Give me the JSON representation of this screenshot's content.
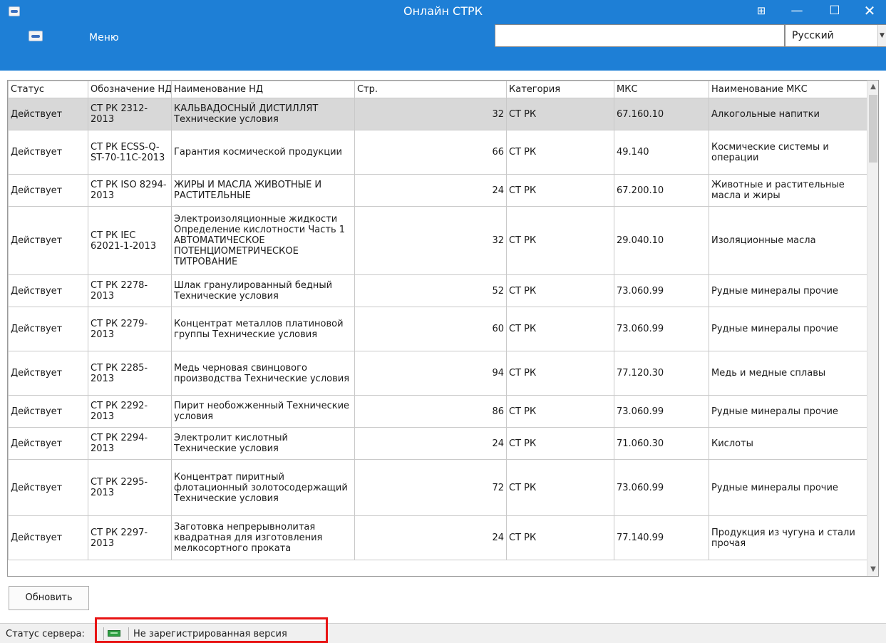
{
  "window": {
    "title": "Онлайн СТРК",
    "pin_icon": "pin-icon",
    "minimize_glyph": "—",
    "maximize_glyph": "☐",
    "close_glyph": "✕"
  },
  "menubar": {
    "menu_label": "Меню",
    "search_value": "",
    "language": "Русский"
  },
  "table": {
    "columns": [
      "Статус",
      "Обозначение НД",
      "Наименование НД",
      "Стр.",
      "Категория",
      "МКС",
      "Наименование МКС"
    ],
    "rows": [
      {
        "status": "Действует",
        "code": "СТ РК 2312-2013",
        "name": " КАЛЬВАДОСНЫЙ ДИСТИЛЛЯТ Технические условия",
        "pages": "32",
        "category": "СТ РК",
        "mks": "67.160.10",
        "mks_name": "Алкогольные напитки"
      },
      {
        "status": "Действует",
        "code": "СТ РК ECSS-Q-ST-70-11C-2013",
        "name": "Гарантия космической продукции",
        "pages": "66",
        "category": "СТ РК",
        "mks": "49.140",
        "mks_name": "Космические системы и операции"
      },
      {
        "status": "Действует",
        "code": "СТ РК ISO 8294-2013",
        "name": "ЖИРЫ И МАСЛА ЖИВОТНЫЕ И РАСТИТЕЛЬНЫЕ",
        "pages": "24",
        "category": "СТ РК",
        "mks": "67.200.10",
        "mks_name": "Животные и растительные масла и жиры"
      },
      {
        "status": "Действует",
        "code": "СТ РК IEC 62021-1-2013",
        "name": "Электроизоляционные жидкости Определение кислотности Часть 1 АВТОМАТИЧЕСКОЕ ПОТЕНЦИОМЕТРИЧЕСКОЕ ТИТРОВАНИЕ",
        "pages": "32",
        "category": "СТ РК",
        "mks": "29.040.10",
        "mks_name": "Изоляционные масла"
      },
      {
        "status": "Действует",
        "code": "СТ РК 2278-2013",
        "name": "Шлак гранулированный бедный Технические условия",
        "pages": "52",
        "category": "СТ РК",
        "mks": "73.060.99",
        "mks_name": "Рудные минералы прочие"
      },
      {
        "status": "Действует",
        "code": "СТ РК 2279-2013",
        "name": "Концентрат металлов платиновой группы Технические условия",
        "pages": "60",
        "category": "СТ РК",
        "mks": "73.060.99",
        "mks_name": "Рудные минералы прочие"
      },
      {
        "status": "Действует",
        "code": "СТ РК 2285-2013",
        "name": "Медь черновая свинцового производства Технические условия",
        "pages": "94",
        "category": "СТ РК",
        "mks": "77.120.30",
        "mks_name": "Медь и медные сплавы"
      },
      {
        "status": "Действует",
        "code": "СТ РК 2292-2013",
        "name": "Пирит необожженный Технические условия",
        "pages": "86",
        "category": "СТ РК",
        "mks": "73.060.99",
        "mks_name": "Рудные минералы прочие"
      },
      {
        "status": "Действует",
        "code": "СТ РК 2294-2013",
        "name": "Электролит кислотный Технические условия",
        "pages": "24",
        "category": "СТ РК",
        "mks": "71.060.30",
        "mks_name": "Кислоты"
      },
      {
        "status": "Действует",
        "code": "СТ РК 2295-2013",
        "name": "Концентрат пиритный флотационный золотосодержащий Технические условия",
        "pages": "72",
        "category": "СТ РК",
        "mks": "73.060.99",
        "mks_name": "Рудные минералы прочие"
      },
      {
        "status": "Действует",
        "code": "СТ РК 2297-2013",
        "name": "Заготовка непрерывнолитая квадратная для изготовления мелкосортного проката",
        "pages": "24",
        "category": "СТ РК",
        "mks": "77.140.99",
        "mks_name": "Продукция из чугуна и стали прочая"
      }
    ]
  },
  "buttons": {
    "refresh": "Обновить"
  },
  "statusbar": {
    "label": "Статус сервера:",
    "indicator_icon": "server-status-icon",
    "indicator_color": "#2ea043",
    "message": "Не зарегистрированная версия"
  },
  "highlight_color": "#e81414"
}
